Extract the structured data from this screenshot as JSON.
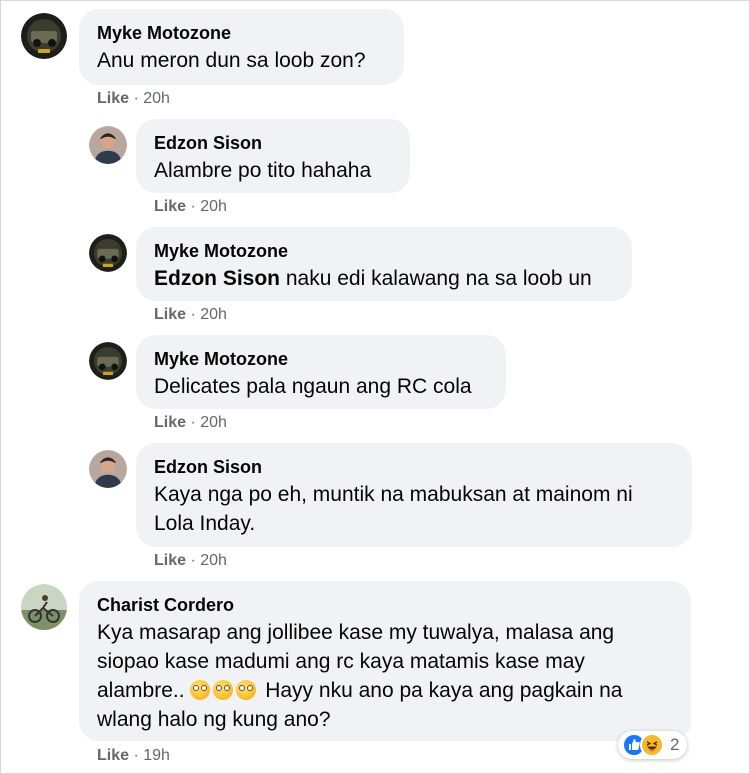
{
  "comments": [
    {
      "author": "Myke Motozone",
      "text": "Anu meron dun sa loob zon?",
      "like": "Like",
      "time": "20h",
      "avatar": "moto-avatar"
    },
    {
      "author": "Edzon Sison",
      "text": "Alambre po tito hahaha",
      "like": "Like",
      "time": "20h",
      "avatar": "person-avatar"
    },
    {
      "author": "Myke Motozone",
      "mention": "Edzon Sison",
      "text": " naku edi kalawang na sa loob un",
      "like": "Like",
      "time": "20h",
      "avatar": "moto-avatar"
    },
    {
      "author": "Myke Motozone",
      "text": "Delicates pala ngaun ang RC cola",
      "like": "Like",
      "time": "20h",
      "avatar": "moto-avatar"
    },
    {
      "author": "Edzon Sison",
      "text_lines": [
        "Kaya nga po eh, muntik na mabuksan at mainom ni",
        "Lola Inday."
      ],
      "like": "Like",
      "time": "20h",
      "avatar": "person-avatar"
    },
    {
      "author": "Charist Cordero",
      "text_lines": [
        "Kya masarap ang jollibee kase my tuwalya, malasa ang",
        "siopao kase madumi ang rc kaya matamis kase may",
        "alambre.. ",
        " Hayy nku ano pa kaya ang pagkain na",
        "wlang halo ng kung ano?"
      ],
      "emojis": [
        "rolling-eyes-emoji",
        "rolling-eyes-emoji",
        "rolling-eyes-emoji"
      ],
      "like": "Like",
      "time": "19h",
      "avatar": "bike-avatar",
      "reactions": {
        "icons": [
          "like-reaction-icon",
          "haha-reaction-icon"
        ],
        "count": "2"
      }
    }
  ],
  "separator": " · ",
  "colors": {
    "bubble": "#f0f2f5",
    "meta": "#65676b",
    "like_blue": "#1877f2"
  }
}
